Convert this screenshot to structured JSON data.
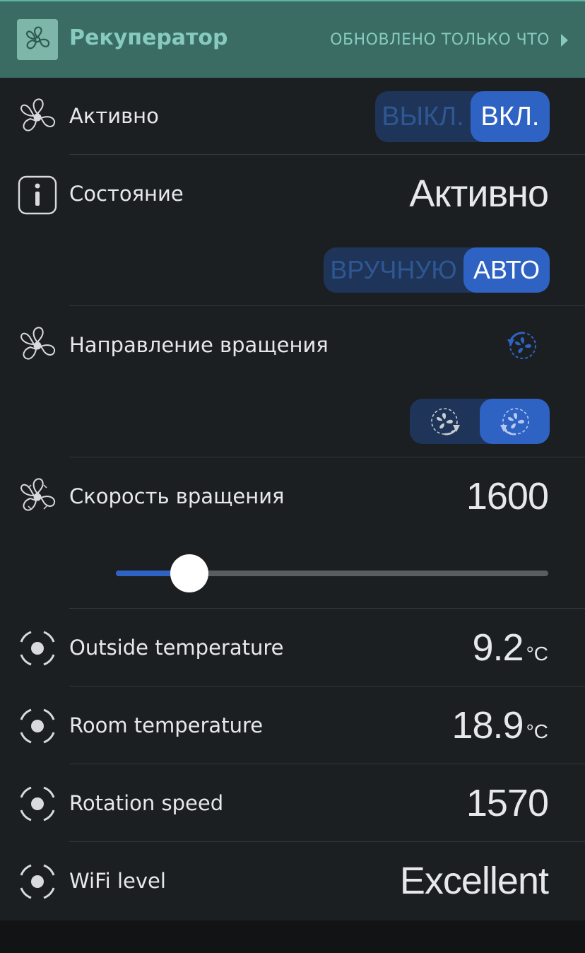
{
  "header": {
    "title": "Рекуператор",
    "updated": "ОБНОВЛЕНО ТОЛЬКО ЧТО",
    "icon": "fan-icon",
    "arrow_icon": "chevron-right-icon"
  },
  "rows": {
    "active": {
      "label": "Активно",
      "icon": "fan-icon",
      "off_label": "ВЫКЛ.",
      "on_label": "ВКЛ.",
      "selected": "on"
    },
    "state": {
      "label": "Состояние",
      "icon": "info-icon",
      "value": "Активно",
      "manual_label": "ВРУЧНУЮ",
      "auto_label": "АВТО",
      "selected": "auto"
    },
    "direction": {
      "label": "Направление вращения",
      "icon": "fan-icon",
      "current_icon": "rotate-counterclockwise-icon",
      "option_icons": [
        "rotate-clockwise-icon",
        "rotate-counterclockwise-icon"
      ],
      "selected": 1
    },
    "speed": {
      "label": "Скорость вращения",
      "icon": "fan-icon",
      "value": "1600",
      "slider_fraction": 0.17
    },
    "outside_temp": {
      "label": "Outside temperature",
      "icon": "sensor-icon",
      "value": "9.2",
      "unit": "°C"
    },
    "room_temp": {
      "label": "Room temperature",
      "icon": "sensor-icon",
      "value": "18.9",
      "unit": "°C"
    },
    "rotation_speed": {
      "label": "Rotation speed",
      "icon": "sensor-icon",
      "value": "1570"
    },
    "wifi_level": {
      "label": "WiFi level",
      "icon": "sensor-icon",
      "value": "Excellent"
    }
  },
  "colors": {
    "header_bg": "#3a6c63",
    "header_text": "#86cbbd",
    "accent": "#2e63c4",
    "toggle_bg": "#1e3458",
    "toggle_inactive_text": "#2e5794"
  }
}
